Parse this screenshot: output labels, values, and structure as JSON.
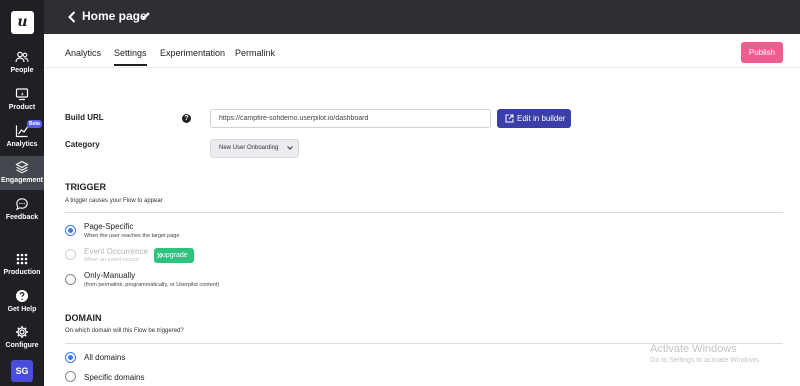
{
  "app": {
    "logo_letter": "u",
    "avatar_initials": "SG"
  },
  "sidebar": {
    "items": [
      {
        "label": "People",
        "icon": "people-icon"
      },
      {
        "label": "Product",
        "icon": "product-icon"
      },
      {
        "label": "Analytics",
        "icon": "analytics-icon",
        "badge": "Beta"
      },
      {
        "label": "Engagement",
        "icon": "engagement-icon",
        "active": true
      },
      {
        "label": "Feedback",
        "icon": "feedback-icon"
      },
      {
        "label": "Production",
        "icon": "grid-icon"
      },
      {
        "label": "Get Help",
        "icon": "help-icon"
      },
      {
        "label": "Configure",
        "icon": "gear-icon"
      }
    ]
  },
  "header": {
    "title": "Home page"
  },
  "tabs": [
    {
      "label": "Analytics"
    },
    {
      "label": "Settings",
      "active": true
    },
    {
      "label": "Experimentation"
    },
    {
      "label": "Permalink"
    }
  ],
  "actions": {
    "publish_label": "Publish"
  },
  "build_url": {
    "label": "Build URL",
    "value": "https://campfire-sofidemo.userpilot.io/dashboard",
    "edit_label": "Edit in builder"
  },
  "category": {
    "label": "Category",
    "selected": "New User Onboarding"
  },
  "trigger": {
    "title": "TRIGGER",
    "subtitle": "A trigger causes your Flow to appear",
    "options": [
      {
        "label": "Page-Specific",
        "sub": "When the user reaches the target page",
        "checked": true
      },
      {
        "label": "Event Occurrence",
        "sub": "When an event occurs",
        "disabled": true,
        "upgrade_label": "upgrade"
      },
      {
        "label": "Only-Manually",
        "sub": "(from permalink, programmatically, or Userpilot content)"
      }
    ]
  },
  "domain": {
    "title": "DOMAIN",
    "subtitle": "On which domain will this Flow be triggered?",
    "options": [
      {
        "label": "All domains",
        "checked": true
      },
      {
        "label": "Specific domains"
      }
    ]
  },
  "watermark": {
    "title": "Activate Windows",
    "subtitle": "Go to Settings to activate Windows."
  },
  "colors": {
    "accent": "#3b3ea8",
    "publish": "#ee5e8c",
    "sidebar": "#1e2024",
    "topbar": "#2d2f33",
    "upgrade": "#2ec27e",
    "radio": "#3b7cf5"
  }
}
